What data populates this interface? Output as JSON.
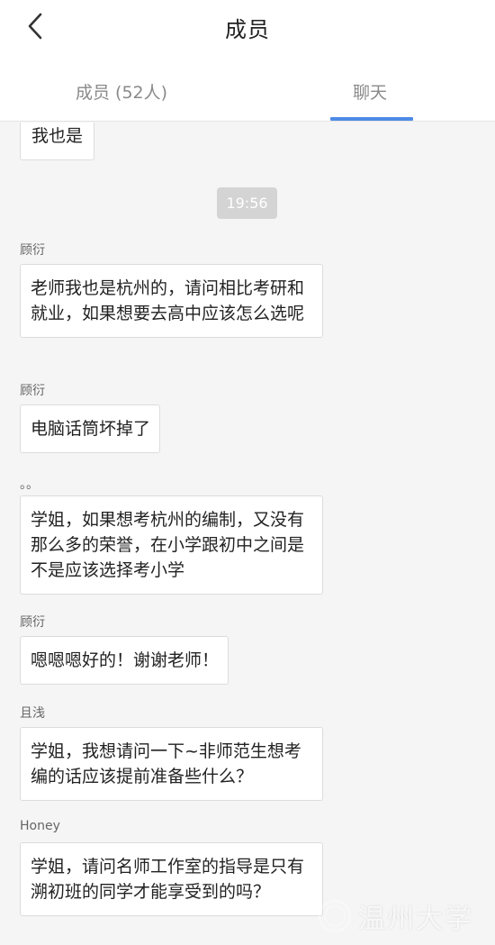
{
  "header": {
    "title": "成员",
    "tabs": [
      {
        "label": "成员 (52人)"
      },
      {
        "label": "聊天"
      }
    ]
  },
  "chat": {
    "timestamp": "19:56",
    "messages": [
      {
        "sender": "",
        "text": "我也是"
      },
      {
        "sender": "顾衍",
        "text": "老师我也是杭州的，请问相比考研和就业，如果想要去高中应该怎么选呢"
      },
      {
        "sender": "顾衍",
        "text": "电脑话筒坏掉了"
      },
      {
        "sender": "。。",
        "text": "学姐，如果想考杭州的编制，又没有那么多的荣誉，在小学跟初中之间是不是应该选择考小学"
      },
      {
        "sender": "顾衍",
        "text": "嗯嗯嗯好的！谢谢老师！"
      },
      {
        "sender": "且浅",
        "text": "学姐，我想请问一下~非师范生想考编的话应该提前准备些什么？"
      },
      {
        "sender": "Honey",
        "text": "学姐，请问名师工作室的指导是只有溯初班的同学才能享受到的吗？"
      }
    ]
  },
  "watermark": {
    "text": "温州大学"
  },
  "colors": {
    "accent": "#4d8ae6",
    "background": "#f5f5f5"
  }
}
